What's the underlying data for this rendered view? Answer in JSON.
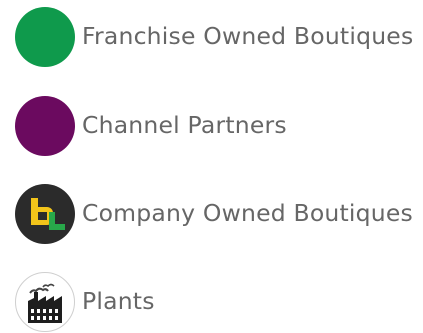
{
  "legend": {
    "items": [
      {
        "label": "Franchise Owned Boutiques",
        "marker": "green-circle",
        "color": "#0f9a4c"
      },
      {
        "label": "Channel Partners",
        "marker": "purple-circle",
        "color": "#6b0a5f"
      },
      {
        "label": "Company Owned Boutiques",
        "marker": "bl-logo-icon",
        "color": "#2b2b2b"
      },
      {
        "label": "Plants",
        "marker": "factory-icon",
        "color": "#222222"
      }
    ]
  }
}
